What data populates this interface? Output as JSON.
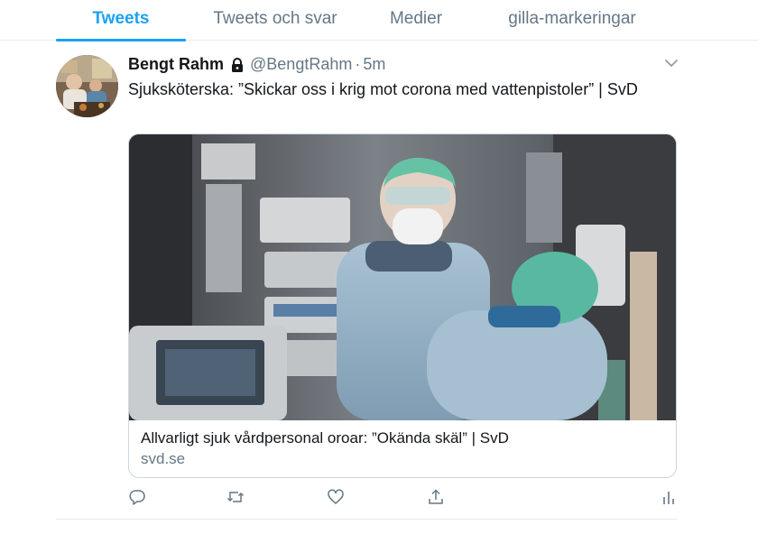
{
  "tabs": [
    {
      "label": "Tweets",
      "active": true
    },
    {
      "label": "Tweets och svar",
      "active": false
    },
    {
      "label": "Medier",
      "active": false
    },
    {
      "label": "gilla-markeringar",
      "active": false
    }
  ],
  "tweet": {
    "author_name": "Bengt Rahm",
    "protected_icon": "lock-icon",
    "handle": "@BengtRahm",
    "separator": "·",
    "time": "5m",
    "text": "Sjuksköterska: ”Skickar oss i krig mot corona med vattenpistoler” | SvD",
    "card": {
      "title": "Allvarligt sjuk vårdpersonal oroar: ”Okända skäl” | SvD",
      "domain": "svd.se"
    },
    "actions": [
      "reply-icon",
      "retweet-icon",
      "like-icon",
      "share-icon",
      "analytics-icon"
    ]
  },
  "colors": {
    "accent": "#1da1f2",
    "text_primary": "#14171a",
    "text_secondary": "#657786",
    "border": "#e6ecf0"
  }
}
